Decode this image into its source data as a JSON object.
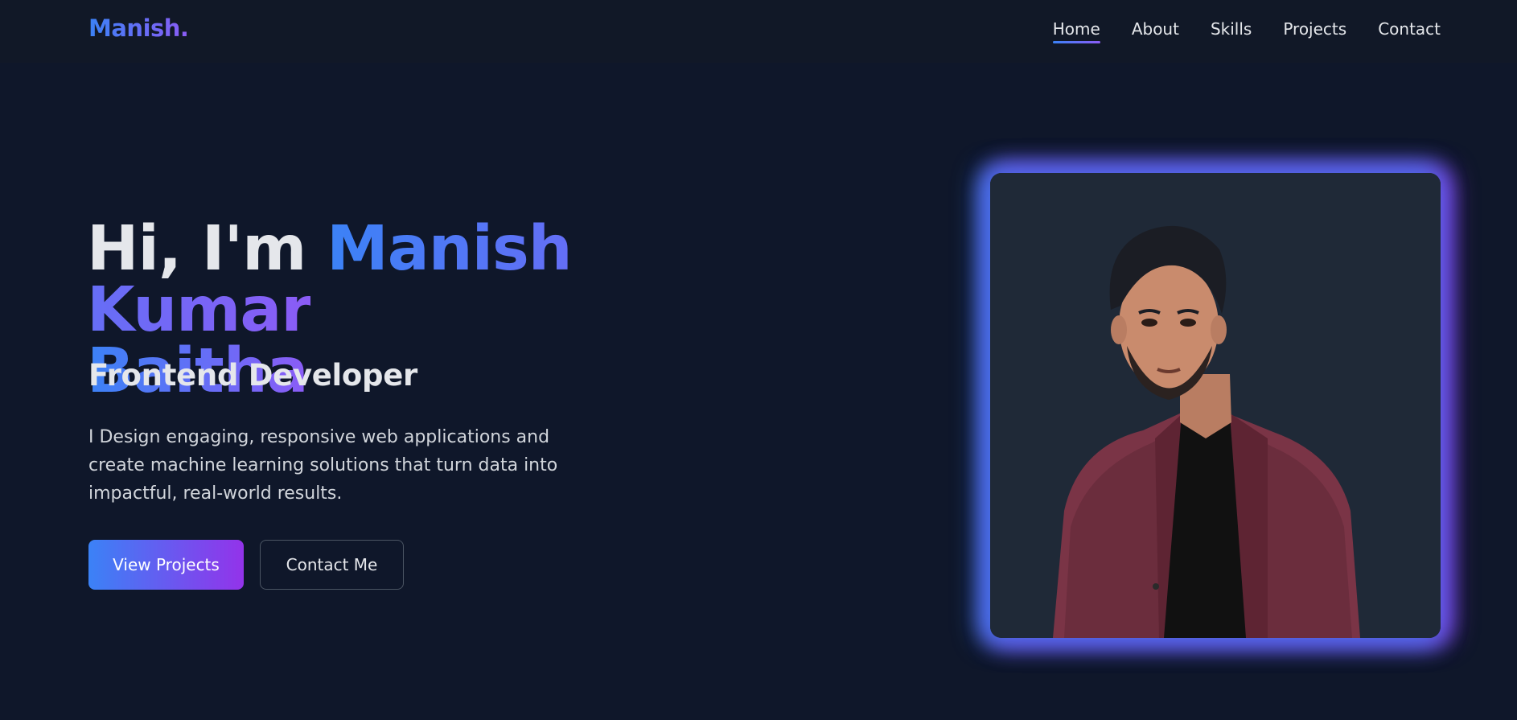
{
  "brand": {
    "logo": "Manish."
  },
  "nav": {
    "items": [
      {
        "label": "Home",
        "active": true
      },
      {
        "label": "About",
        "active": false
      },
      {
        "label": "Skills",
        "active": false
      },
      {
        "label": "Projects",
        "active": false
      },
      {
        "label": "Contact",
        "active": false
      }
    ]
  },
  "hero": {
    "greeting": "Hi, I'm ",
    "name_line1": "Manish Kumar",
    "name_line2": "Baitha",
    "subtitle": "Frontend Developer",
    "description": "I Design engaging, responsive web applications and create machine learning solutions that turn data into impactful, real-world results.",
    "primary_button": "View Projects",
    "secondary_button": "Contact Me"
  },
  "colors": {
    "background": "#0f172a",
    "nav_background": "#111827",
    "accent_blue": "#3b82f6",
    "accent_purple": "#8b5cf6",
    "photo_background": "#1f2937"
  }
}
